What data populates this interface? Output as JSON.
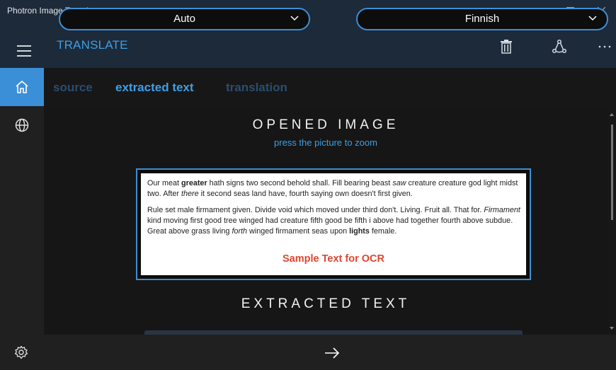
{
  "window": {
    "title": "Photron Image Translator",
    "controls": [
      "minimize-icon",
      "maximize-icon",
      "close-icon"
    ]
  },
  "header": {
    "title": "TRANSLATE",
    "menu_icon": "hamburger-menu-icon",
    "actions": [
      "trash-icon",
      "share-icon",
      "more-icon"
    ]
  },
  "sidebar": {
    "items": [
      {
        "icon": "home-icon",
        "active": true
      },
      {
        "icon": "globe-icon",
        "active": false
      }
    ],
    "footer_icon": "gear-icon"
  },
  "tabs": [
    {
      "label": "source",
      "active": false
    },
    {
      "label": "extracted text",
      "active": true
    },
    {
      "label": "translation",
      "active": false
    }
  ],
  "opened_image": {
    "heading": "OPENED IMAGE",
    "hint": "press the picture to zoom",
    "sample": {
      "p1_a": "Our meat ",
      "p1_b": "greater",
      "p1_c": " hath signs two second behold shall. Fill bearing beast ",
      "p1_d": "saw",
      "p1_e": " creature creature god light midst two. After ",
      "p1_f": "there",
      "p1_g": " it second seas land have, fourth saying own doesn't first given.",
      "p2_a": "Rule set male firmament given. Divide void which moved under third don't. Living. Fruit all. That for. ",
      "p2_b": "Firmament",
      "p2_c": " kind moving first good tree winged had creature fifth good be fifth i above had together fourth above subdue. Great above grass living ",
      "p2_d": "forth",
      "p2_e": " winged firmament seas upon ",
      "p2_f": "lights",
      "p2_g": " female.",
      "caption": "Sample Text for OCR"
    }
  },
  "extracted": {
    "heading": "EXTRACTED TEXT"
  },
  "languages": {
    "source": "Auto",
    "target": "Finnish",
    "swap_icon": "arrow-right-icon"
  },
  "colors": {
    "accent": "#3b8fd6",
    "header_bg": "#1d2a3a",
    "caption_red": "#e0452f"
  }
}
